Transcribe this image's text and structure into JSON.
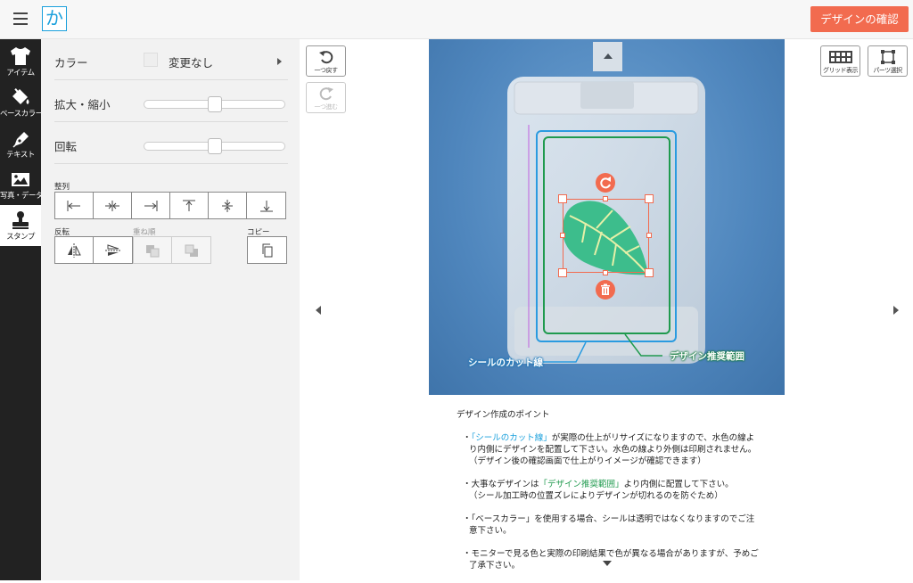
{
  "header": {
    "logo_text": "か",
    "confirm_label": "デザインの確認"
  },
  "sidebar": {
    "items": [
      {
        "label": "アイテム",
        "icon": "tshirt-icon"
      },
      {
        "label": "ベースカラー",
        "icon": "paint-bucket-icon"
      },
      {
        "label": "テキスト",
        "icon": "pen-icon"
      },
      {
        "label": "写真・データ",
        "icon": "image-icon"
      },
      {
        "label": "スタンプ",
        "icon": "stamp-icon",
        "active": true
      }
    ]
  },
  "panel": {
    "color_label": "カラー",
    "color_value": "変更なし",
    "scale_label": "拡大・縮小",
    "scale_value": 0.5,
    "rotate_label": "回転",
    "rotate_value": 0.5,
    "align_label": "整列",
    "flip_label": "反転",
    "order_label": "重ね順",
    "copy_label": "コピー"
  },
  "toolbar": {
    "undo_label": "一つ戻す",
    "redo_label": "一つ進む",
    "grid_label": "グリッド表示",
    "parts_label": "パーツ選択"
  },
  "canvas": {
    "cut_line_label": "シールのカット線",
    "design_area_label": "デザイン推奨範囲",
    "colors": {
      "accent": "#f26b4f",
      "cut_line": "#2a9be0",
      "design_area": "#1f9a4e",
      "leaf": "#3dbd8c"
    }
  },
  "points": {
    "title": "デザイン作成のポイント",
    "p1_bullet": "・",
    "p1_highlight": "「シールのカット線」",
    "p1_text": "が実際の仕上がリサイズになりますので、水色の線より内側にデザインを配置して下さい。水色の線より外側は印刷されません。",
    "p1_note": "（デザイン後の確認画面で仕上がりイメージが確認できます）",
    "p2_bullet": "・",
    "p2_pre": "大事なデザインは",
    "p2_highlight": "「デザイン推奨範囲」",
    "p2_text": "より内側に配置して下さい。",
    "p2_note": "（シール加工時の位置ズレによりデザインが切れるのを防ぐため）",
    "p3": "・「ベースカラー」を使用する場合、シールは透明ではなくなりますのでご注意下さい。",
    "p4": "・モニターで見る色と実際の印刷結果で色が異なる場合がありますが、予めご了承下さい。"
  }
}
